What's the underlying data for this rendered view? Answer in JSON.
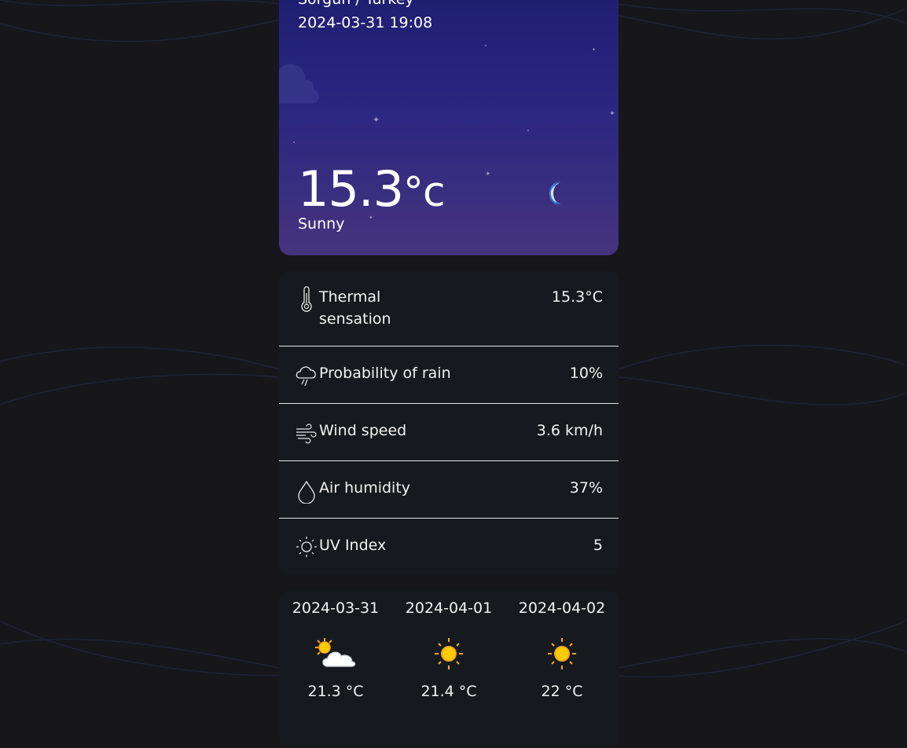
{
  "current": {
    "location": "Sorgun / Turkey",
    "datetime": "2024-03-31 19:08",
    "temperature": "15.3",
    "temperature_unit": "°c",
    "condition": "Sunny",
    "icon": "crescent-moon-icon"
  },
  "details": [
    {
      "icon": "thermometer-icon",
      "label": "Thermal sensation",
      "value": "15.3°C"
    },
    {
      "icon": "rain-cloud-icon",
      "label": "Probability of rain",
      "value": "10%"
    },
    {
      "icon": "wind-icon",
      "label": "Wind speed",
      "value": "3.6 km/h"
    },
    {
      "icon": "droplet-icon",
      "label": "Air humidity",
      "value": "37%"
    },
    {
      "icon": "sun-outline-icon",
      "label": "UV Index",
      "value": "5"
    }
  ],
  "forecast": [
    {
      "date": "2024-03-31",
      "icon": "partly-cloudy-icon",
      "temp": "21.3 °C"
    },
    {
      "date": "2024-04-01",
      "icon": "sun-icon",
      "temp": "21.4 °C"
    },
    {
      "date": "2024-04-02",
      "icon": "sun-icon",
      "temp": "22 °C"
    }
  ],
  "colors": {
    "page_bg": "#16161b",
    "card_bg": "#161a1f",
    "hero_top": "#1f1f72",
    "hero_bottom": "#45347e",
    "moon": "#2f86e0",
    "sun": "#ffc107"
  }
}
